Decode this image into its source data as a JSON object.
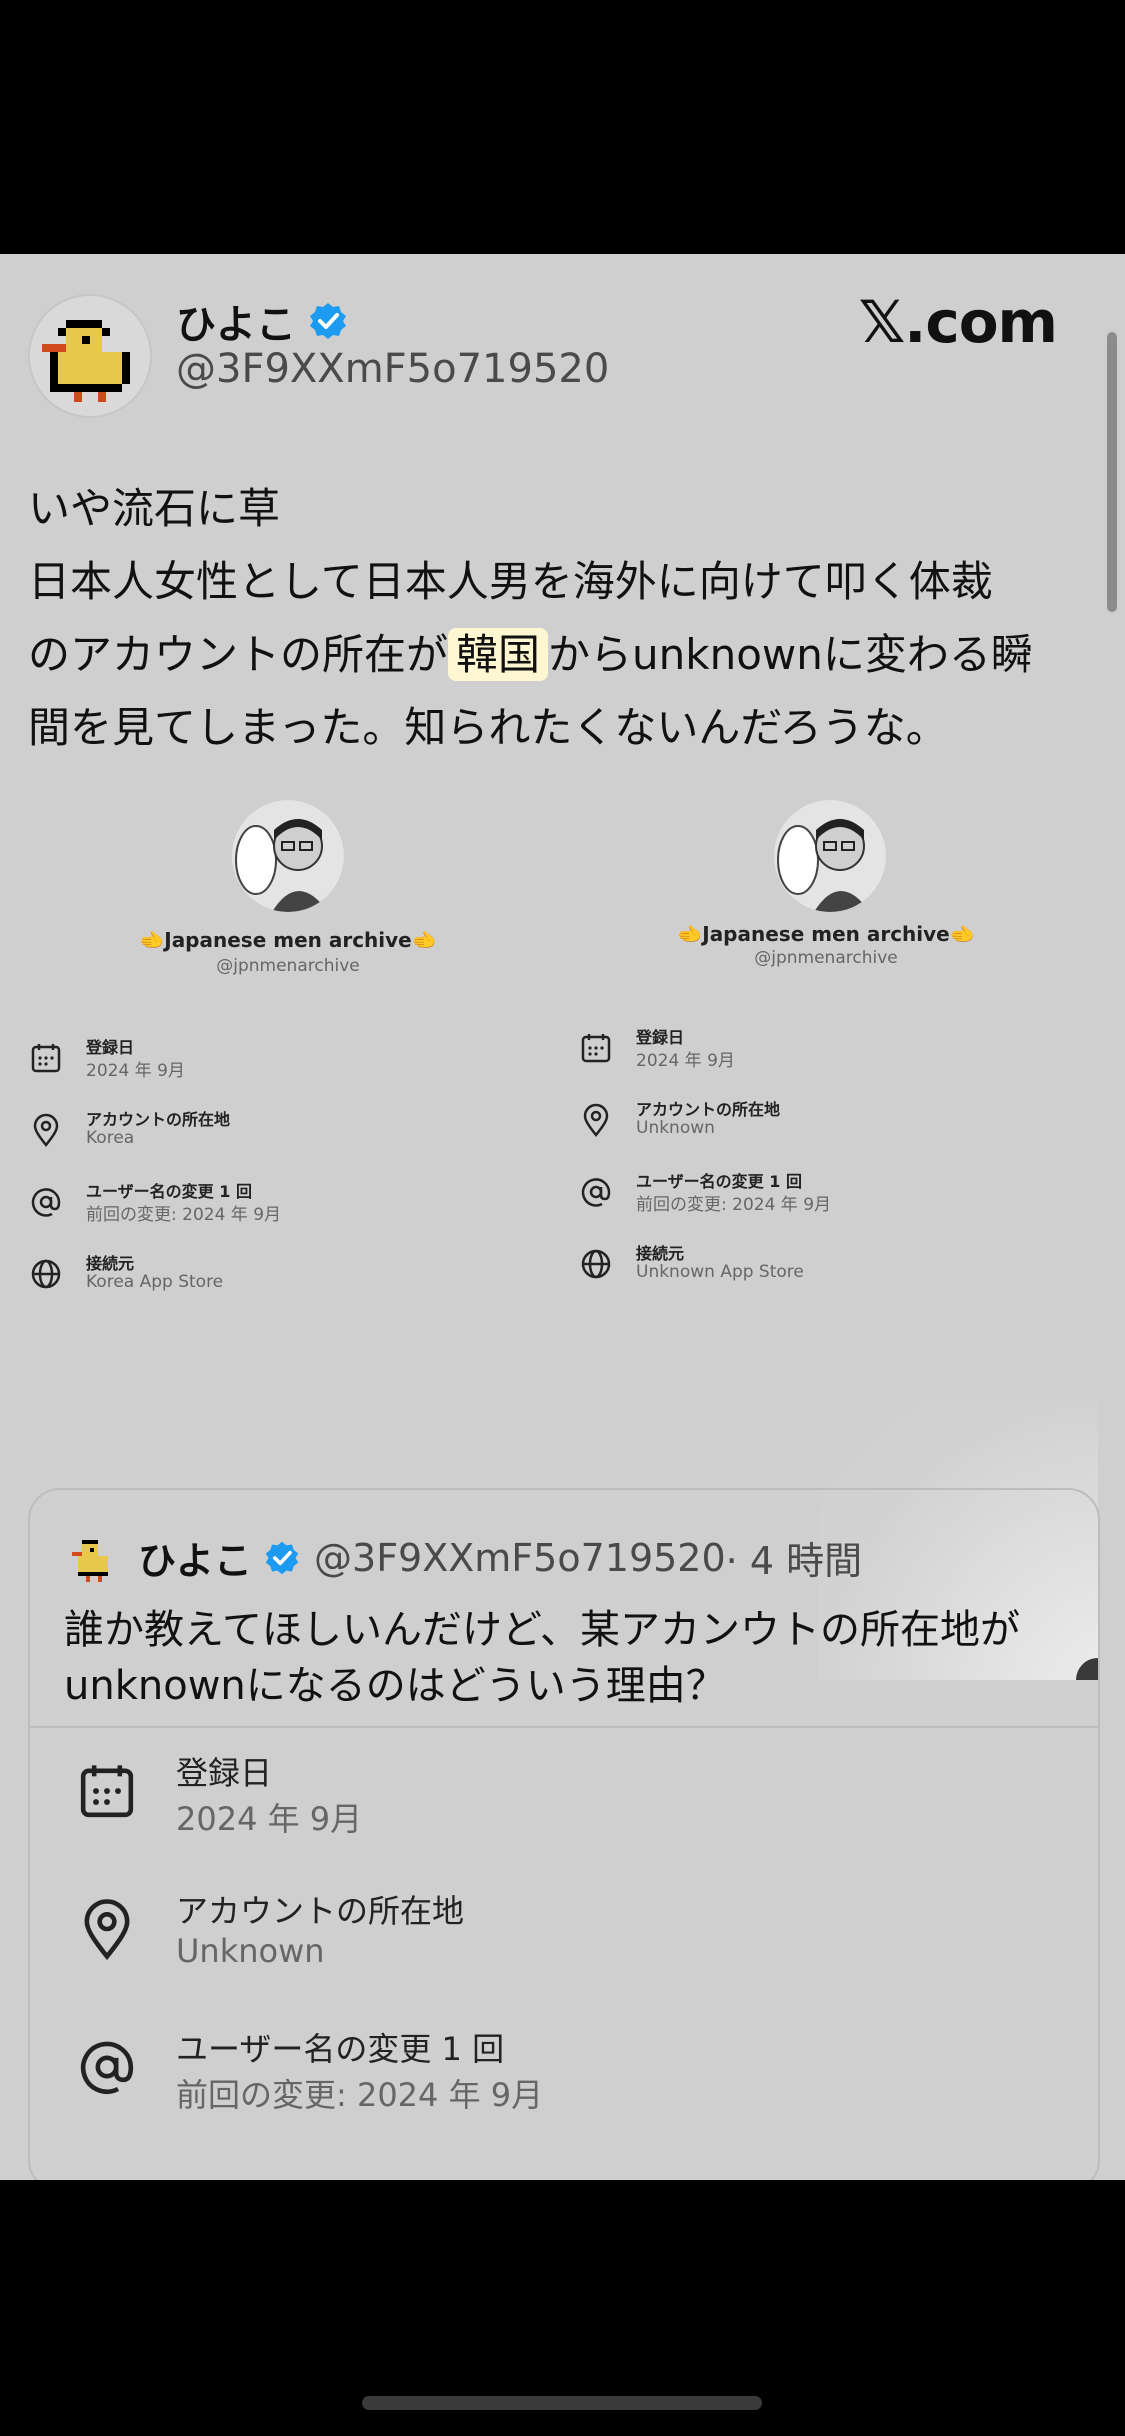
{
  "brand": "𝕏.com",
  "author": {
    "name": "ひよこ",
    "handle": "@3F9XXmF5o719520"
  },
  "tweet": {
    "line1": "いや流石に草",
    "line2": "日本人女性として日本人男を海外に向けて叩く体裁",
    "line3_pre": "のアカウントの所在が",
    "line3_highlight": "韓国",
    "line3_post": "からunknownに変わる瞬",
    "line4": "間を見てしまった。知られたくないんだろうな。"
  },
  "embedded_screenshot": {
    "left": {
      "account_name": "🫲Japanese men archive🫲",
      "account_handle": "@jpnmenarchive",
      "rows": [
        {
          "icon": "calendar-icon",
          "label": "登録日",
          "value": "2024 年 9月"
        },
        {
          "icon": "location-pin-icon",
          "label": "アカウントの所在地",
          "value": "Korea"
        },
        {
          "icon": "at-sign-icon",
          "label": "ユーザー名の変更 1 回",
          "value": "前回の変更: 2024 年 9月"
        },
        {
          "icon": "globe-icon",
          "label": "接続元",
          "value": "Korea App Store"
        }
      ]
    },
    "right": {
      "account_name": "🫲Japanese men archive🫲",
      "account_handle": "@jpnmenarchive",
      "rows": [
        {
          "icon": "calendar-icon",
          "label": "登録日",
          "value": "2024 年 9月"
        },
        {
          "icon": "location-pin-icon",
          "label": "アカウントの所在地",
          "value": "Unknown"
        },
        {
          "icon": "at-sign-icon",
          "label": "ユーザー名の変更 1 回",
          "value": "前回の変更: 2024 年 9月"
        },
        {
          "icon": "globe-icon",
          "label": "接続元",
          "value": "Unknown App Store"
        }
      ]
    }
  },
  "quote": {
    "name": "ひよこ",
    "handle": "@3F9XXmF5o719520",
    "time": "· 4 時間",
    "line1": "誰か教えてほしいんだけど、某アカンウトの所在地が",
    "line2": "unknownになるのはどういう理由？",
    "rows": [
      {
        "icon": "calendar-icon",
        "label": "登録日",
        "value": "2024 年 9月"
      },
      {
        "icon": "location-pin-icon",
        "label": "アカウントの所在地",
        "value": "Unknown"
      },
      {
        "icon": "at-sign-icon",
        "label": "ユーザー名の変更 1 回",
        "value": "前回の変更: 2024 年 9月"
      }
    ]
  },
  "colors": {
    "sheet_bg": "#cfcfcf",
    "verified_blue": "#1d9bf0",
    "highlight": "#fff6d2"
  }
}
